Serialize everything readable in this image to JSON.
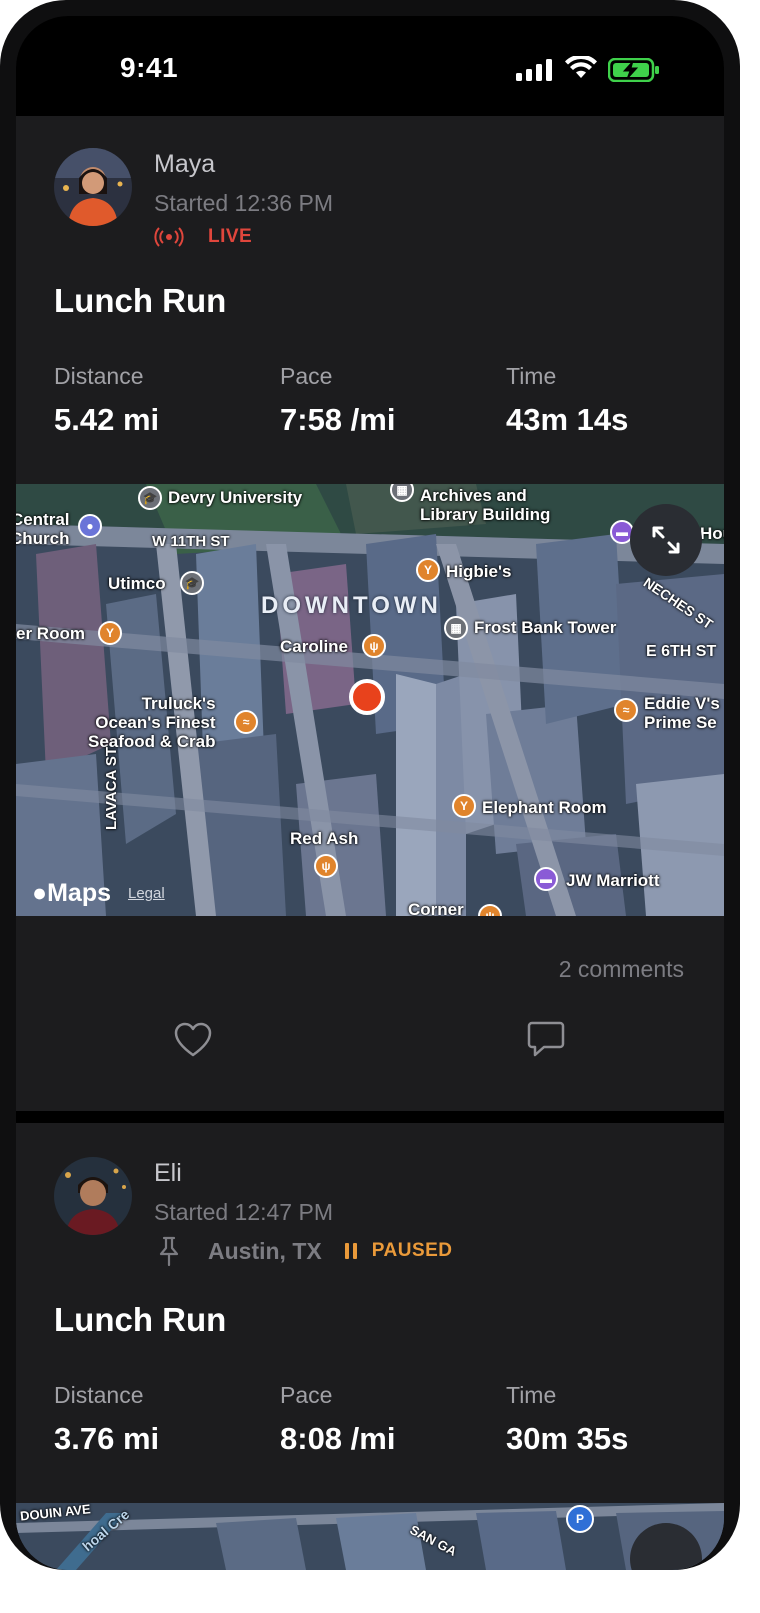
{
  "status_bar": {
    "time": "9:41"
  },
  "feed": [
    {
      "user_name": "Maya",
      "started": "Started 12:36 PM",
      "state_label": "LIVE",
      "title": "Lunch Run",
      "stats": [
        {
          "label": "Distance",
          "value": "5.42 mi"
        },
        {
          "label": "Pace",
          "value": "7:58 /mi"
        },
        {
          "label": "Time",
          "value": "43m 14s"
        }
      ],
      "comments": "2 comments",
      "map": {
        "area_label": "DOWNTOWN",
        "attribution": "Maps",
        "legal": "Legal",
        "places": [
          {
            "name": "Devry University",
            "icon": "graduation-cap-icon"
          },
          {
            "name": "Archives and\nLibrary Building",
            "icon": "building-icon"
          },
          {
            "name": "Central\nChurch",
            "icon": "church-icon"
          },
          {
            "name": "W 11TH ST",
            "icon": ""
          },
          {
            "name": "Utimco",
            "icon": "graduation-cap-icon"
          },
          {
            "name": "Higbie's",
            "icon": "cocktail-icon"
          },
          {
            "name": "er Room",
            "icon": "cocktail-icon"
          },
          {
            "name": "Caroline",
            "icon": "fork-knife-icon"
          },
          {
            "name": "Frost Bank Tower",
            "icon": "building-icon"
          },
          {
            "name": "NECHES ST",
            "icon": ""
          },
          {
            "name": "E 6TH ST",
            "icon": ""
          },
          {
            "name": "Truluck's\nOcean's Finest\nSeafood & Crab",
            "icon": "seafood-icon"
          },
          {
            "name": "Eddie V's\nPrime Se",
            "icon": "seafood-icon"
          },
          {
            "name": "LAVACA ST",
            "icon": ""
          },
          {
            "name": "Elephant Room",
            "icon": "cocktail-icon"
          },
          {
            "name": "Red Ash",
            "icon": "fork-knife-icon"
          },
          {
            "name": "JW Marriott",
            "icon": "bed-icon"
          },
          {
            "name": "Corner",
            "icon": "fork-knife-icon"
          },
          {
            "name": "Hou",
            "icon": "bed-icon"
          }
        ]
      }
    },
    {
      "user_name": "Eli",
      "started": "Started 12:47 PM",
      "location": "Austin, TX",
      "state_label": "PAUSED",
      "title": "Lunch Run",
      "stats": [
        {
          "label": "Distance",
          "value": "3.76 mi"
        },
        {
          "label": "Pace",
          "value": "8:08 /mi"
        },
        {
          "label": "Time",
          "value": "30m 35s"
        }
      ],
      "map": {
        "places": [
          {
            "name": "DOUIN AVE",
            "icon": ""
          },
          {
            "name": "SAN GA",
            "icon": ""
          },
          {
            "name": "P",
            "icon": "parking-icon"
          },
          {
            "name": "hoal Cre",
            "icon": ""
          }
        ]
      }
    }
  ],
  "colors": {
    "live": "#e0463c",
    "paused": "#ea9a3a",
    "background": "#1c1c1e",
    "map_base": "#3b4a5e"
  }
}
